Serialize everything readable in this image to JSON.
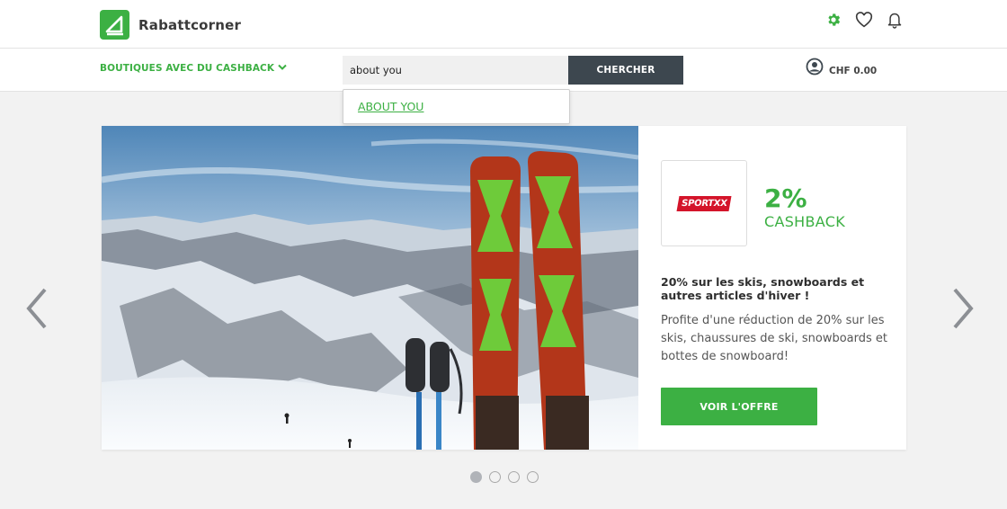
{
  "brand": {
    "name": "Rabattcorner",
    "accent": "#3cb043"
  },
  "header_icons": [
    {
      "name": "gear-icon",
      "color": "#3cb043"
    },
    {
      "name": "heart-icon"
    },
    {
      "name": "bell-icon"
    }
  ],
  "nav": {
    "shops_label": "BOUTIQUES AVEC DU CASHBACK",
    "search": {
      "value": "about you",
      "button_label": "CHERCHER"
    },
    "account": {
      "balance": "CHF 0.00"
    }
  },
  "suggestions": [
    {
      "label": "ABOUT YOU"
    }
  ],
  "hero": {
    "shop_logo_text": "SPORTXX",
    "cashback_percent": "2%",
    "cashback_label": "CASHBACK",
    "offer_title": "20% sur les skis, snowboards et autres articles d'hiver !",
    "offer_description": "Profite d'une réduction de 20% sur les skis, chaussures de ski, snowboards et bottes de snowboard!",
    "cta_label": "VOIR L'OFFRE"
  },
  "carousel": {
    "slide_count": 4,
    "active_index": 0
  }
}
